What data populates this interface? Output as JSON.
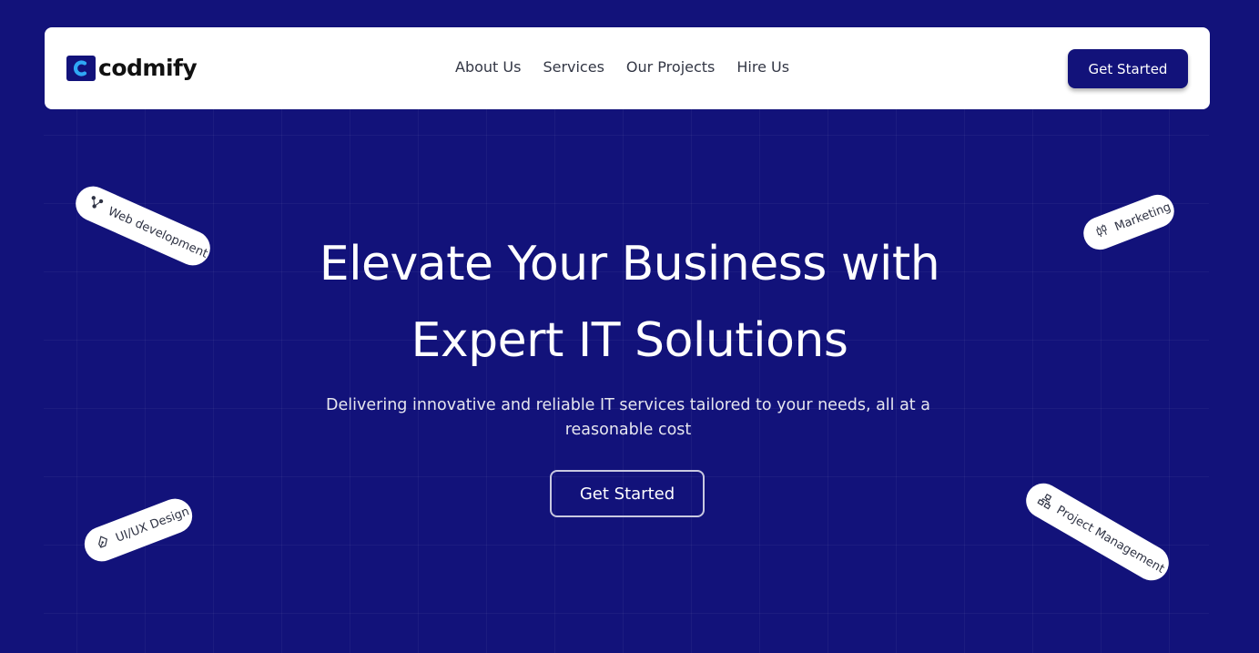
{
  "brand": {
    "name": "codmify",
    "logo_icon": "c-logo-icon",
    "color": "#12127a"
  },
  "nav": {
    "links": [
      "About Us",
      "Services",
      "Our Projects",
      "Hire Us"
    ],
    "cta_label": "Get Started"
  },
  "hero": {
    "title_line1": "Elevate Your Business with",
    "title_line2": "Expert IT Solutions",
    "subtitle": "Delivering innovative and reliable IT services tailored to your needs, all at a reasonable cost",
    "cta_label": "Get Started"
  },
  "tags": {
    "web": {
      "label": "Web development",
      "icon": "nodes-icon"
    },
    "marketing": {
      "label": "Marketing",
      "icon": "candlestick-icon"
    },
    "uiux": {
      "label": "UI/UX Design",
      "icon": "pen-tool-icon"
    },
    "pm": {
      "label": "Project Management",
      "icon": "hierarchy-icon"
    }
  },
  "colors": {
    "background": "#12127a",
    "surface": "#ffffff",
    "text_dark": "#333745"
  }
}
